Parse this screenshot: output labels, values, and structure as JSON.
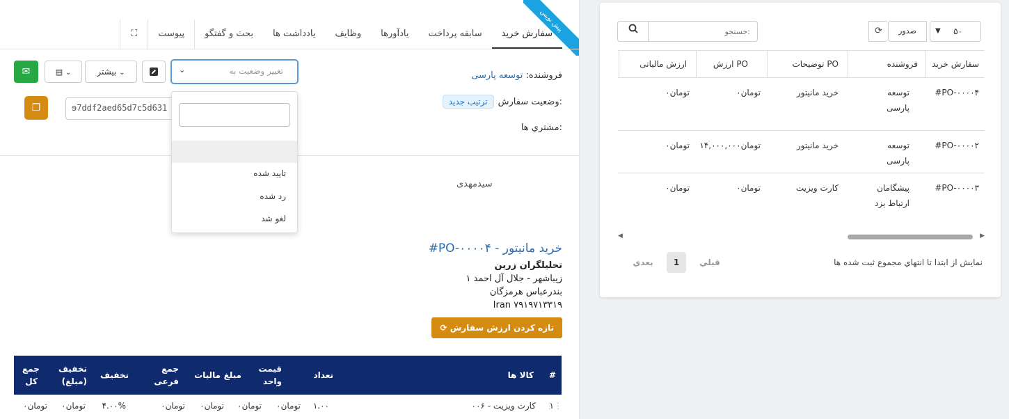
{
  "tabs": [
    {
      "label": "سفارش خرید",
      "active": true
    },
    {
      "label": "سابقه پرداخت"
    },
    {
      "label": "یادآورها"
    },
    {
      "label": "وظایف"
    },
    {
      "label": "یادداشت ها"
    },
    {
      "label": "بحث و گفتگو"
    },
    {
      "label": "پیوست"
    }
  ],
  "ribbon": "پیش نویس",
  "vendor": {
    "label": "فروشنده:",
    "value": "توسعه پارسی"
  },
  "order_status": {
    "label": "وضعیت سفارش:",
    "badge": "ترتیب جدید"
  },
  "customers": {
    "label": "مشتري ها:"
  },
  "status_select": {
    "placeholder": "تغییر وضعیت به"
  },
  "status_options": [
    "تایید شده",
    "رد شده",
    "لغو شد"
  ],
  "more_button": "بیشتر",
  "hash_value": "ɘ7ddf2aed65d7c5d631",
  "assignee": "سیدمهدی",
  "po": {
    "title": "#PO-۰۰۰۰۴ - خرید مانیتور",
    "company": "تحلیلگران زرین",
    "address1": "زیباشهر - جلال آل احمد ۱",
    "address2": "بندرعباس هرمزگان",
    "address3": "Iran ۷۹۱۹۷۱۳۳۱۹",
    "refresh_button": "تازه کردن ارزش سفارش"
  },
  "items_table": {
    "headers": [
      "#",
      "کالا ها",
      "تعداد",
      "قیمت واحد",
      "مبلغ",
      "مالیات",
      "جمع فرعی",
      "تخفیف",
      "تخفیف (مبلغ)",
      "جمع کل"
    ],
    "row": [
      "۱",
      "۰۰۶ - کارت ویزیت",
      "۱.۰۰",
      "تومان۰",
      "تومان۰",
      "تومان۰",
      "تومان۰",
      "۴.۰۰%",
      "تومان۰",
      "تومان۰"
    ]
  },
  "list": {
    "length": "۵۰",
    "export": "صدور",
    "search_placeholder": "جستجو:",
    "headers": [
      "سفارش خرید",
      "فروشنده",
      "توضیحات PO",
      "ارزش PO",
      "ارزش مالیاتی"
    ],
    "rows": [
      {
        "po": "#PO-۰۰۰۰۴",
        "vendor1": "توسعه",
        "vendor2": "پارسی",
        "desc": "خرید مانیتور",
        "value": "تومان۰",
        "tax": "تومان۰"
      },
      {
        "po": "#PO-۰۰۰۰۲",
        "vendor1": "توسعه",
        "vendor2": "پارسی",
        "desc": "خرید مانیتور",
        "value": "تومان۱۴,۰۰۰,۰۰۰",
        "tax": "تومان۰"
      },
      {
        "po": "#PO-۰۰۰۰۳",
        "vendor1": "پیشگامان",
        "vendor2": "ارتباط یزد",
        "desc": "کارت ویزیت",
        "value": "تومان۰",
        "tax": "تومان۰"
      }
    ],
    "info": "نمایش از ابتدا تا انتهاي مجموع ثبت شده ها",
    "pager": {
      "prev": "قبلي",
      "current": "1",
      "next": "بعدي"
    }
  }
}
